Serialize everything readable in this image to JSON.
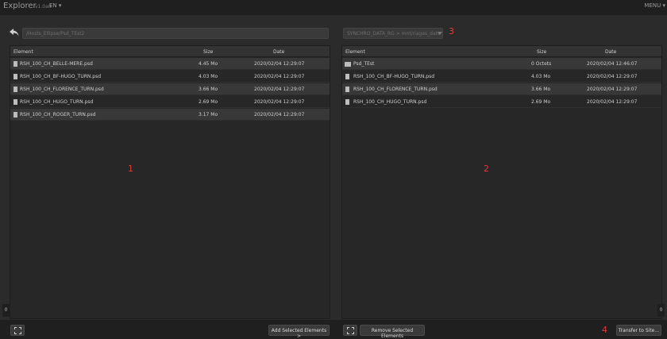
{
  "app": {
    "title": "Explorer",
    "version": "v1.0a0",
    "language": "EN",
    "menu_label": "MENU"
  },
  "left": {
    "path_value": "/Hosts_Ellipse/Psd_TEst2",
    "columns": {
      "element": "Element",
      "size": "Size",
      "date": "Date"
    },
    "rows": [
      {
        "name": "RSH_100_CH_BELLE-MERE.psd",
        "size": "4.45 Mo",
        "date": "2020/02/04 12:29:07"
      },
      {
        "name": "RSH_100_CH_BF-HUGO_TURN.psd",
        "size": "4.03 Mo",
        "date": "2020/02/04 12:29:07"
      },
      {
        "name": "RSH_100_CH_FLORENCE_TURN.psd",
        "size": "3.66 Mo",
        "date": "2020/02/04 12:29:07"
      },
      {
        "name": "RSH_100_CH_HUGO_TURN.psd",
        "size": "2.69 Mo",
        "date": "2020/02/04 12:29:07"
      },
      {
        "name": "RSH_100_CH_ROGER_TURN.psd",
        "size": "3.17 Mo",
        "date": "2020/02/04 12:29:07"
      }
    ],
    "add_button": "Add Selected Elements >"
  },
  "right": {
    "site_value": "SYNCHRO_DATA_RG > mnt/riages_dats",
    "columns": {
      "element": "Element",
      "size": "Size",
      "date": "Date"
    },
    "rows": [
      {
        "name": "Psd_TEst",
        "size": "0 Octets",
        "date": "2020/02/04 12:46:07",
        "is_folder": true
      },
      {
        "name": "RSH_100_CH_BF-HUGO_TURN.psd",
        "size": "4.03 Mo",
        "date": "2020/02/04 12:29:07"
      },
      {
        "name": "RSH_100_CH_FLORENCE_TURN.psd",
        "size": "3.66 Mo",
        "date": "2020/02/04 12:29:07"
      },
      {
        "name": "RSH_100_CH_HUGO_TURN.psd",
        "size": "2.69 Mo",
        "date": "2020/02/04 12:29:07"
      }
    ],
    "remove_button": "Remove Selected Elements",
    "transfer_button": "Transfer to Site..."
  },
  "annotations": {
    "n1": "1",
    "n2": "2",
    "n3": "3",
    "n4": "4"
  },
  "side_tab": "0",
  "colors": {
    "background": "#2b2b2b",
    "bar": "#1f1f1f",
    "annotation": "#e23a3a"
  }
}
